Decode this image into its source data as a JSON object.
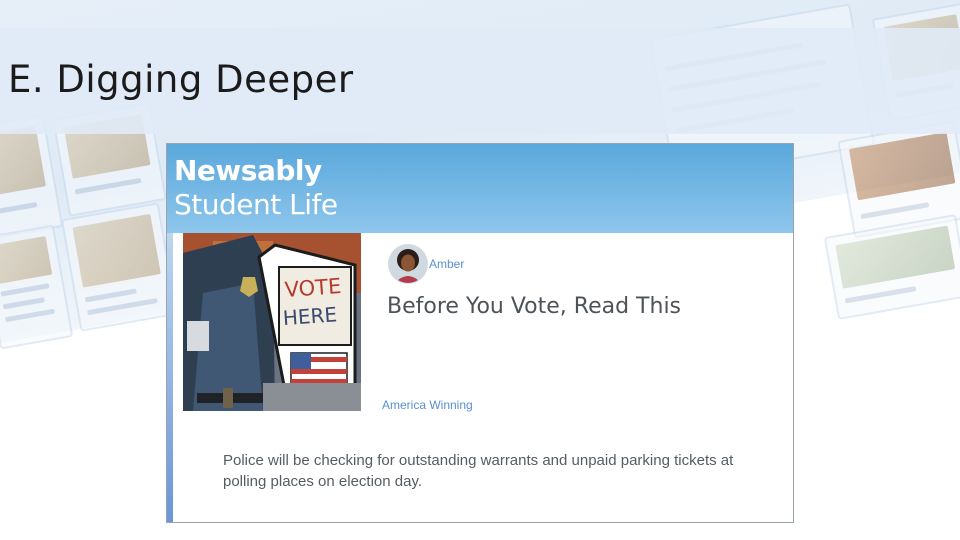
{
  "slide": {
    "title": "E. Digging Deeper"
  },
  "post": {
    "brand": "Newsably",
    "section": "Student Life",
    "author": "Amber",
    "headline": "Before You Vote, Read This",
    "source": "America Winning",
    "body": "Police will be checking for outstanding warrants and unpaid parking tickets at polling places on election day.",
    "image_sign": {
      "line1": "VOTE",
      "line2": "HERE"
    }
  },
  "colors": {
    "header_top": "#5aa8dc",
    "header_bottom": "#8ec6ec",
    "link": "#5b8fd0",
    "headline": "#4e5358",
    "banner": "#e0ebf7"
  }
}
